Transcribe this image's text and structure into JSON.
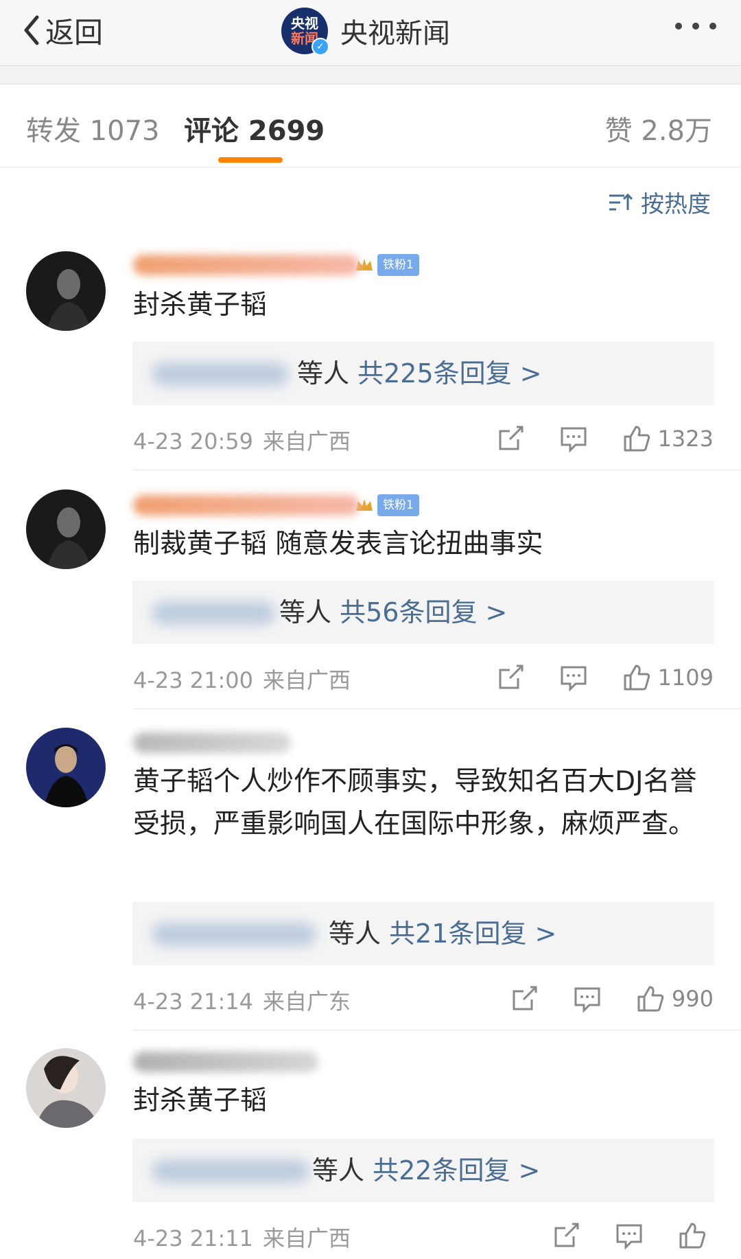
{
  "nav": {
    "back_label": "返回",
    "logo_line1": "央视",
    "logo_line2": "新闻",
    "title": "央视新闻"
  },
  "tabs": {
    "repost": "转发 1073",
    "comment": "评论 2699",
    "like": "赞 2.8万",
    "active_color": "#ff8200"
  },
  "sort_label": "按热度",
  "badge_label": "铁粉1",
  "link_color": "#4a6d93",
  "comments": [
    {
      "text": "封杀黄子韬",
      "replies_suffix": "等人",
      "replies_count": "共225条回复 >",
      "time": "4-23 20:59",
      "location": "来自广西",
      "likes": "1323"
    },
    {
      "text": "制裁黄子韬  随意发表言论扭曲事实",
      "replies_suffix": "等人",
      "replies_count": "共56条回复 >",
      "time": "4-23 21:00",
      "location": "来自广西",
      "likes": "1109"
    },
    {
      "text": "黄子韬个人炒作不顾事实，导致知名百大DJ名誉受损，严重影响国人在国际中形象，麻烦严查。",
      "replies_suffix": "等人",
      "replies_count": "共21条回复 >",
      "time": "4-23 21:14",
      "location": "来自广东",
      "likes": "990"
    },
    {
      "text": "封杀黄子韬",
      "replies_suffix": "等人",
      "replies_count": "共22条回复 >",
      "time": "4-23 21:11",
      "location": "来自广西",
      "likes": ""
    }
  ]
}
